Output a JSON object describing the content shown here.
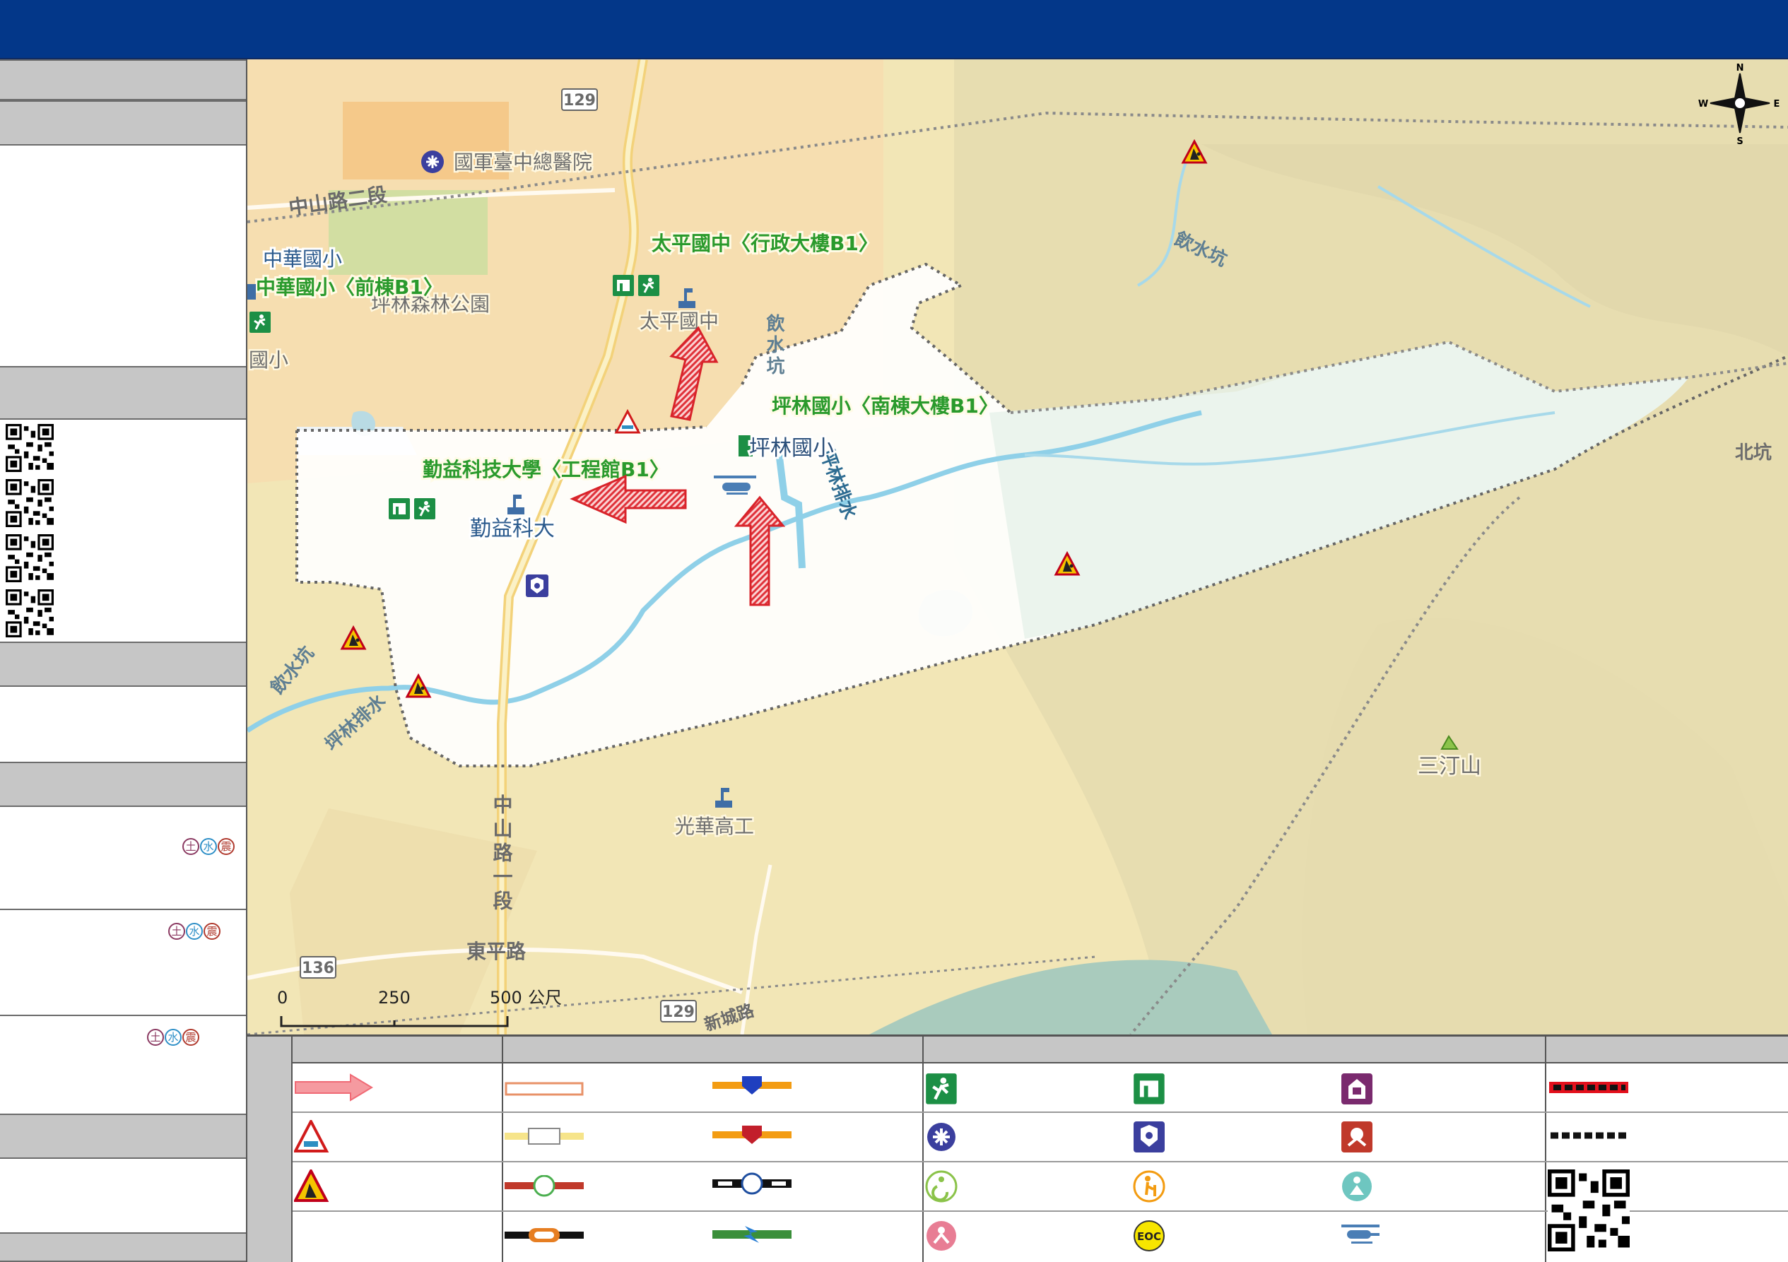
{
  "header": {
    "title": ""
  },
  "sidebar": {
    "hazard_badges": {
      "landslide": "土",
      "flood": "水",
      "earthquake": "震"
    },
    "colors": {
      "landslide": "#8b3a62",
      "flood": "#2e8fc7",
      "earthquake": "#b03a2e"
    }
  },
  "map": {
    "north_labels": {
      "n": "N",
      "s": "S",
      "e": "E",
      "w": "W"
    },
    "shelters": {
      "taiping_jh_admin": "太平國中〈行政大樓B1〉",
      "pinglin_es_south": "坪林國小〈南棟大樓B1〉",
      "chinyi_univ_eng": "勤益科技大學〈工程館B1〉",
      "zhonghua_es_front": "中華國小〈前棟B1〉",
      "zhonghua_es": "中華國小"
    },
    "places": {
      "hospital": "國軍臺中總醫院",
      "forest_park": "坪林森林公園",
      "taiping_jh": "太平國中",
      "pinglin_es": "坪林國小",
      "chinyi_univ": "勤益科大",
      "guanghua_vs": "光華高工",
      "mountain": "三汀山",
      "school_fragment": "國小"
    },
    "waters": {
      "yinshui_keng_1": "飲水坑",
      "yinshui_keng_2": "飲水坑",
      "yinshui_keng_3": "飲水坑",
      "pinglin_drain_1": "坪林排水",
      "pinglin_drain_2": "坪林排水",
      "bei_keng": "北坑"
    },
    "roads": {
      "zhongshan_2": "中山路二段",
      "zhongshan_1": "中山路一段",
      "dongping": "東平路",
      "xincheng_fragment": "新城路",
      "route_129a": "129",
      "route_129b": "129",
      "route_136": "136"
    },
    "scale": {
      "t0": "0",
      "t250": "250",
      "t500": "500",
      "unit": "公尺"
    }
  },
  "legend": {
    "qr_label": "",
    "eoc_label": "EOC"
  }
}
